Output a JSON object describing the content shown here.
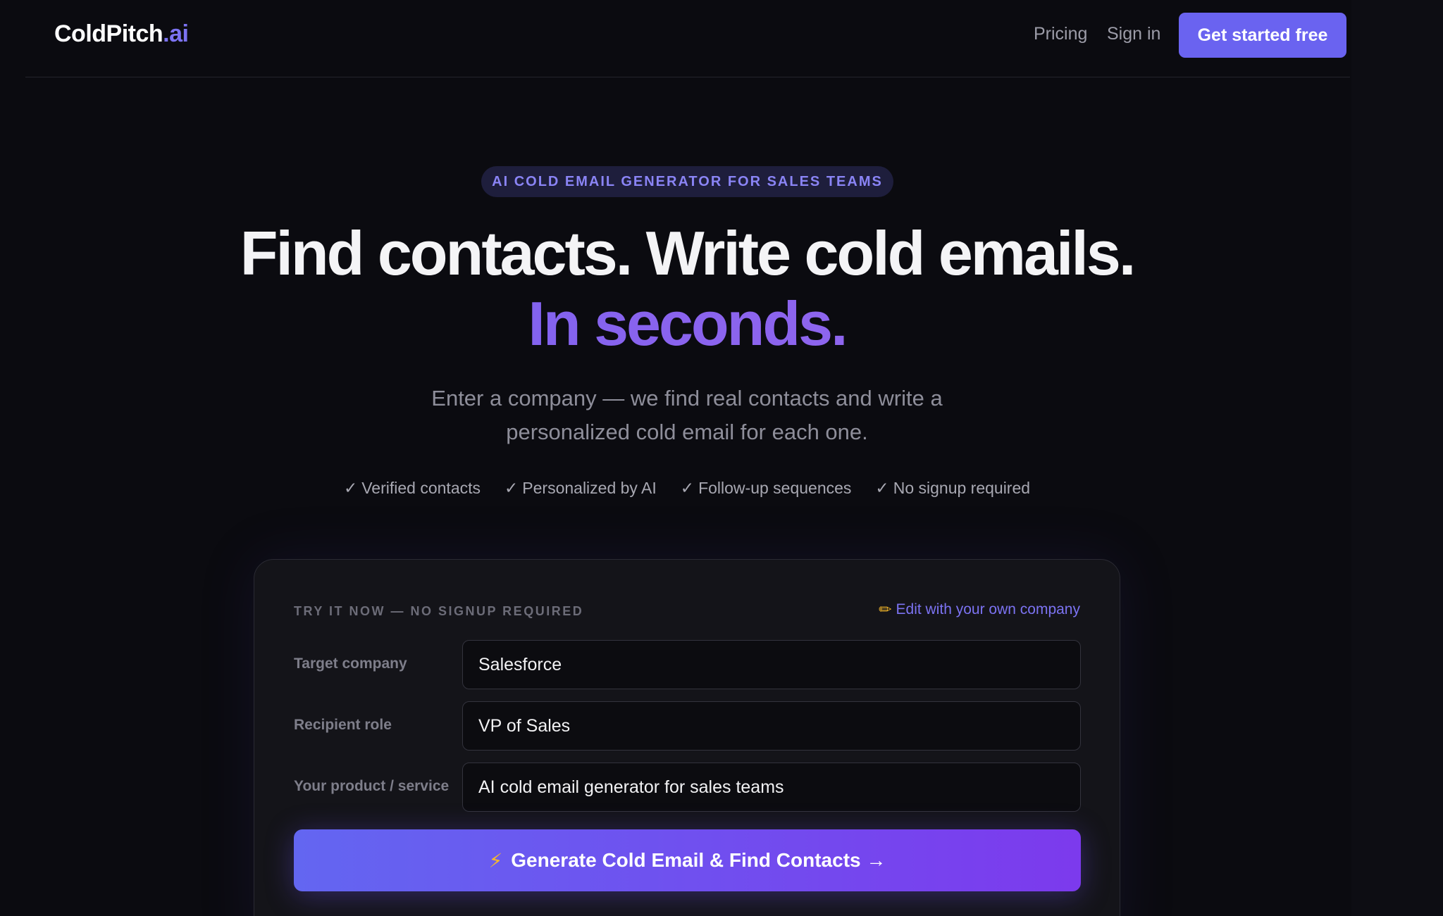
{
  "header": {
    "logo_main": "ColdPitch",
    "logo_accent": ".ai",
    "nav": {
      "pricing": "Pricing",
      "sign_in": "Sign in"
    },
    "cta": "Get started free"
  },
  "hero": {
    "badge": "AI COLD EMAIL GENERATOR FOR SALES TEAMS",
    "headline": "Find contacts. Write cold emails.",
    "headline_accent": "In seconds.",
    "subtitle_line1": "Enter a company — we find real contacts and write a",
    "subtitle_line2": "personalized cold email for each one.",
    "features": [
      "Verified contacts",
      "Personalized by AI",
      "Follow-up sequences",
      "No signup required"
    ],
    "check_glyph": "✓"
  },
  "demo": {
    "eyebrow": "TRY IT NOW — NO SIGNUP REQUIRED",
    "edit_link": "Edit with your own company",
    "fields": {
      "company_label": "Target company",
      "company_value": "Salesforce",
      "role_label": "Recipient role",
      "role_value": "VP of Sales",
      "product_label": "Your product / service",
      "product_value": "AI cold email generator for sales teams"
    },
    "generate_button": "Generate Cold Email & Find Contacts →"
  },
  "colors": {
    "background": "#0b0b10",
    "accent": "#6a63f0",
    "card": "#141419",
    "muted_text": "#8e8e9a"
  },
  "icons": {
    "edit": "pencil-icon",
    "generate": "lightning-bolt-icon"
  }
}
